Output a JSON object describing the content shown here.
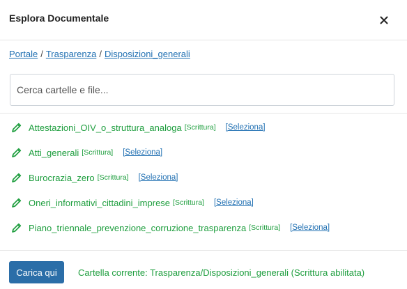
{
  "dialog": {
    "title": "Esplora Documentale",
    "close_icon": "close-icon"
  },
  "breadcrumb": {
    "items": [
      "Portale",
      "Trasparenza",
      "Disposizioni_generali"
    ],
    "separator": "/"
  },
  "search": {
    "placeholder": "Cerca cartelle e file...",
    "value": ""
  },
  "folders": [
    {
      "name": "Attestazioni_OIV_o_struttura_analoga",
      "permission": "[Scrittura]",
      "action": "[Seleziona]",
      "icon": "pencil-icon"
    },
    {
      "name": "Atti_generali",
      "permission": "[Scrittura]",
      "action": "[Seleziona]",
      "icon": "pencil-icon"
    },
    {
      "name": "Burocrazia_zero",
      "permission": "[Scrittura]",
      "action": "[Seleziona]",
      "icon": "pencil-icon"
    },
    {
      "name": "Oneri_informativi_cittadini_imprese",
      "permission": "[Scrittura]",
      "action": "[Seleziona]",
      "icon": "pencil-icon"
    },
    {
      "name": "Piano_triennale_prevenzione_corruzione_trasparenza",
      "permission": "[Scrittura]",
      "action": "[Seleziona]",
      "icon": "pencil-icon"
    }
  ],
  "footer": {
    "load_button": "Carica qui",
    "current_folder": "Cartella corrente: Trasparenza/Disposizioni_generali (Scrittura abilitata)"
  },
  "colors": {
    "folder_green": "#1e9e3e",
    "link_blue": "#1f6fb2",
    "button_blue": "#2b6ea8"
  }
}
